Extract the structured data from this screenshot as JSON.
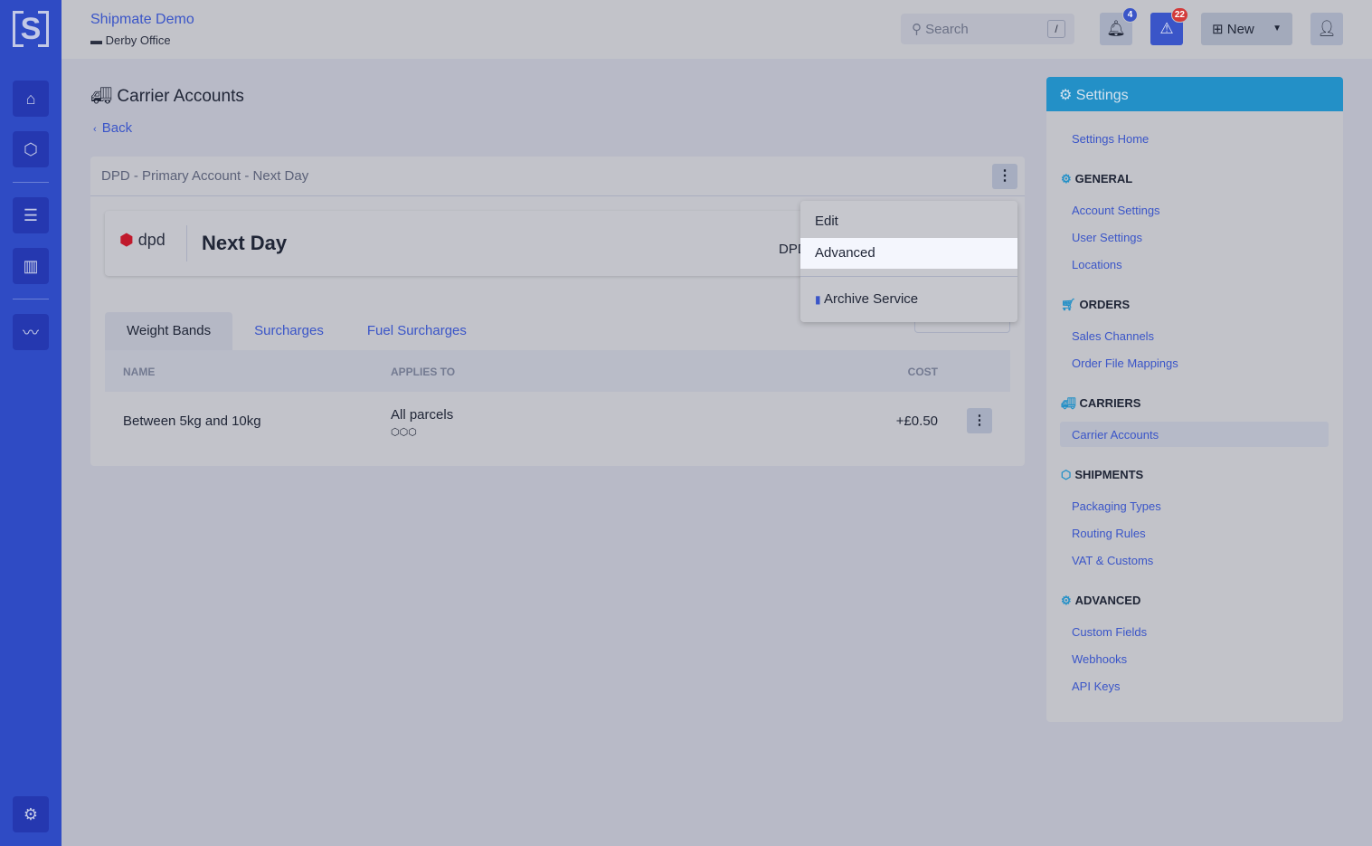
{
  "app": {
    "logo": "S",
    "org_name": "Shipmate Demo",
    "location": "Derby Office"
  },
  "sidebar": {
    "items": [
      {
        "icon": "home-icon"
      },
      {
        "icon": "box-icon"
      },
      {
        "icon": "contacts-icon"
      },
      {
        "icon": "barcode-icon"
      },
      {
        "icon": "chart-line-icon"
      },
      {
        "icon": "gear-icon"
      }
    ]
  },
  "header": {
    "search_placeholder": "Search",
    "search_shortcut": "/",
    "notifications_count": "4",
    "alerts_count": "22",
    "new_label": "New"
  },
  "page": {
    "title": "Carrier Accounts",
    "back_label": "Back"
  },
  "card": {
    "title": "DPD - Primary Account - Next Day",
    "service_name": "Next Day",
    "carrier_logo_text": "dpd",
    "carrier_label_partial": "DPD"
  },
  "tabs": [
    {
      "label": "Weight Bands",
      "active": true
    },
    {
      "label": "Surcharges"
    },
    {
      "label": "Fuel Surcharges"
    }
  ],
  "table": {
    "columns": [
      "NAME",
      "APPLIES TO",
      "COST"
    ],
    "rows": [
      {
        "name": "Between 5kg and 10kg",
        "applies_to": "All parcels",
        "cost": "+£0.50"
      }
    ]
  },
  "menu": {
    "items": [
      "Edit",
      "Advanced",
      "Archive Service"
    ],
    "highlighted": "Advanced"
  },
  "settings": {
    "title": "Settings",
    "home": "Settings Home",
    "sections": [
      {
        "title": "GENERAL",
        "items": [
          "Account Settings",
          "User Settings",
          "Locations"
        ]
      },
      {
        "title": "ORDERS",
        "items": [
          "Sales Channels",
          "Order File Mappings"
        ]
      },
      {
        "title": "CARRIERS",
        "items": [
          "Carrier Accounts"
        ]
      },
      {
        "title": "SHIPMENTS",
        "items": [
          "Packaging Types",
          "Routing Rules",
          "VAT & Customs"
        ]
      },
      {
        "title": "ADVANCED",
        "items": [
          "Custom Fields",
          "Webhooks",
          "API Keys"
        ]
      }
    ],
    "active": "Carrier Accounts"
  },
  "colors": {
    "sidebar": "#2f4bc4",
    "accent": "#3a55c8",
    "settings_header": "#2390c7",
    "alert_badge": "#d33a3a",
    "dpd_red": "#c0192c"
  }
}
